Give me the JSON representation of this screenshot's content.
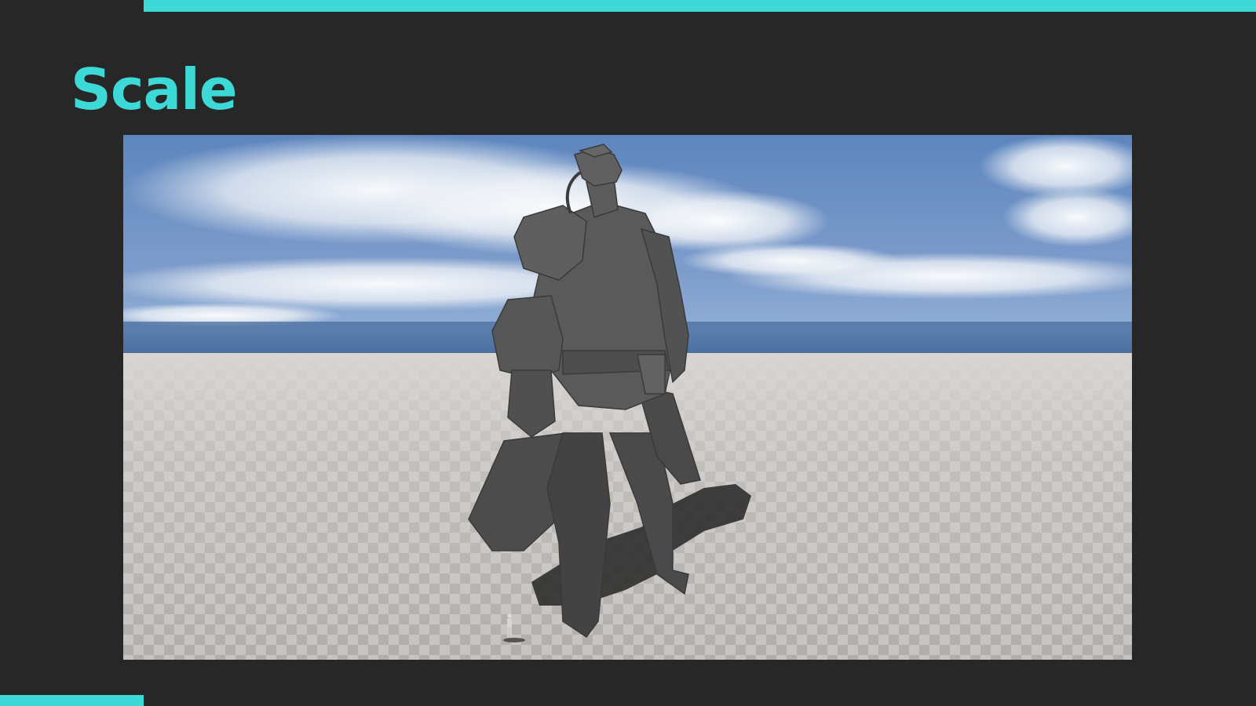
{
  "slide": {
    "title": "Scale"
  },
  "colors": {
    "background": "#272727",
    "accent": "#3dd9d6",
    "sky_top": "#5d86be",
    "horizon": "#3d6494",
    "floor_light": "#c7c3c0",
    "floor_dark": "#aca8a5",
    "character": "#555555"
  },
  "viewport_image": {
    "subject": "giant-mech-character",
    "reference": "human-scale-mannequin"
  }
}
